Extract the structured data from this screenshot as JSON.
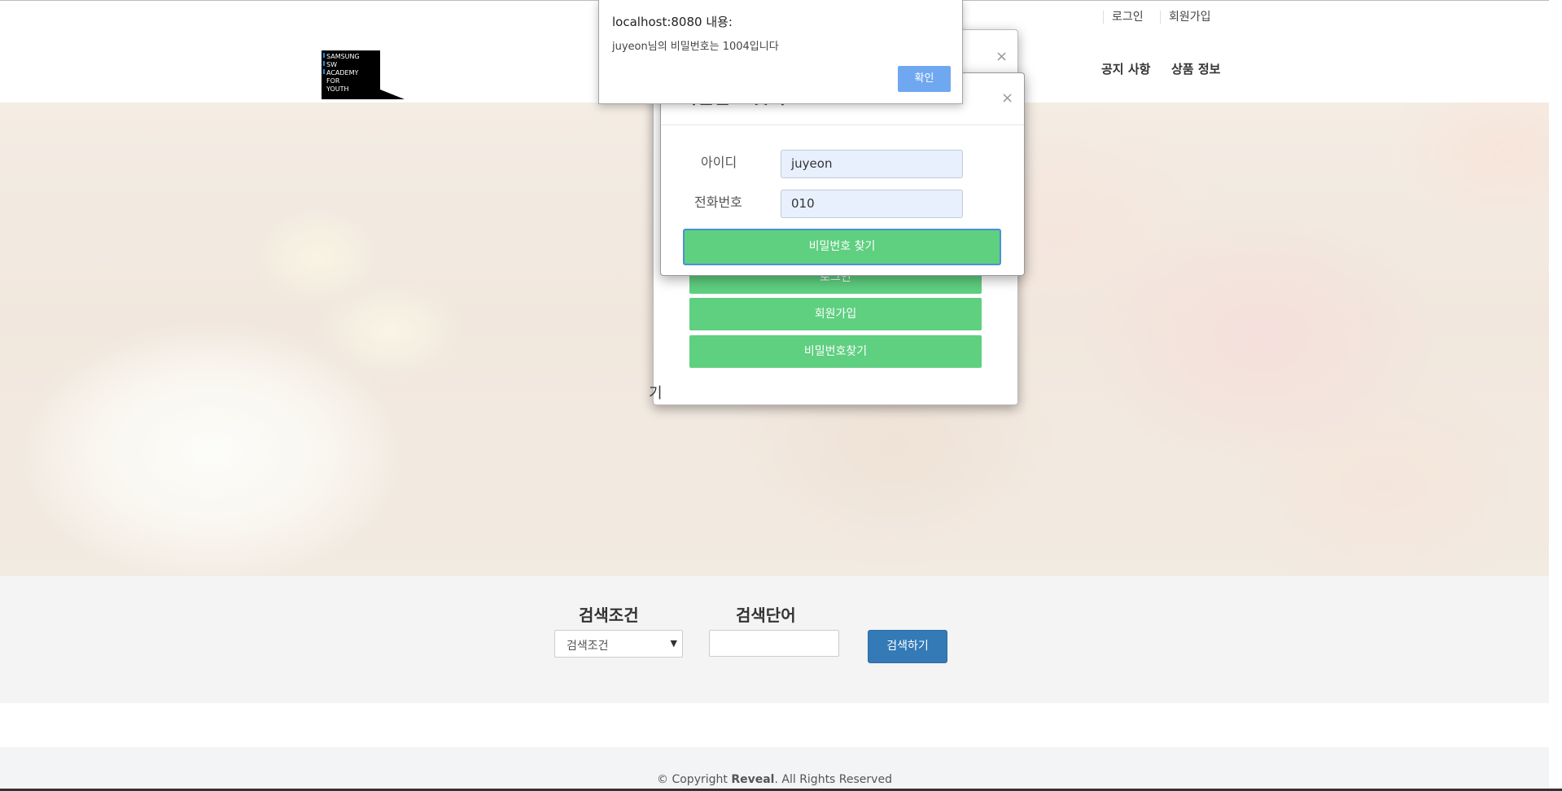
{
  "topbar": {
    "login": "로그인",
    "signup": "회원가입"
  },
  "header": {
    "logo_lines": [
      "SAMSUNG",
      "SW",
      "ACADEMY",
      "FOR",
      "YOUTH"
    ],
    "nav": [
      "공지 사항",
      "상품 정보"
    ]
  },
  "search": {
    "condition_label": "검색조건",
    "keyword_label": "검색단어",
    "select_value": "검색조건",
    "keyword_value": "",
    "button": "검색하기"
  },
  "footer": {
    "copyright_prefix": "© Copyright ",
    "brand": "Reveal",
    "copyright_suffix": ". All Rights Reserved"
  },
  "login_modal": {
    "buttons": [
      "로그인",
      "회원가입",
      "비밀번호찾기"
    ],
    "partial_text": "기",
    "close": "×"
  },
  "find_modal": {
    "title": "비밀번호 찾기",
    "close": "×",
    "id_label": "아이디",
    "id_value": "juyeon",
    "phone_label": "전화번호",
    "phone_value": "010",
    "submit": "비밀번호 찾기"
  },
  "alert": {
    "title": "localhost:8080 내용:",
    "message": "juyeon님의 비밀번호는 1004입니다",
    "ok": "확인"
  },
  "colors": {
    "green": "#5fcf80",
    "blue": "#337ab7",
    "alert_ok": "#6fa8f0"
  }
}
